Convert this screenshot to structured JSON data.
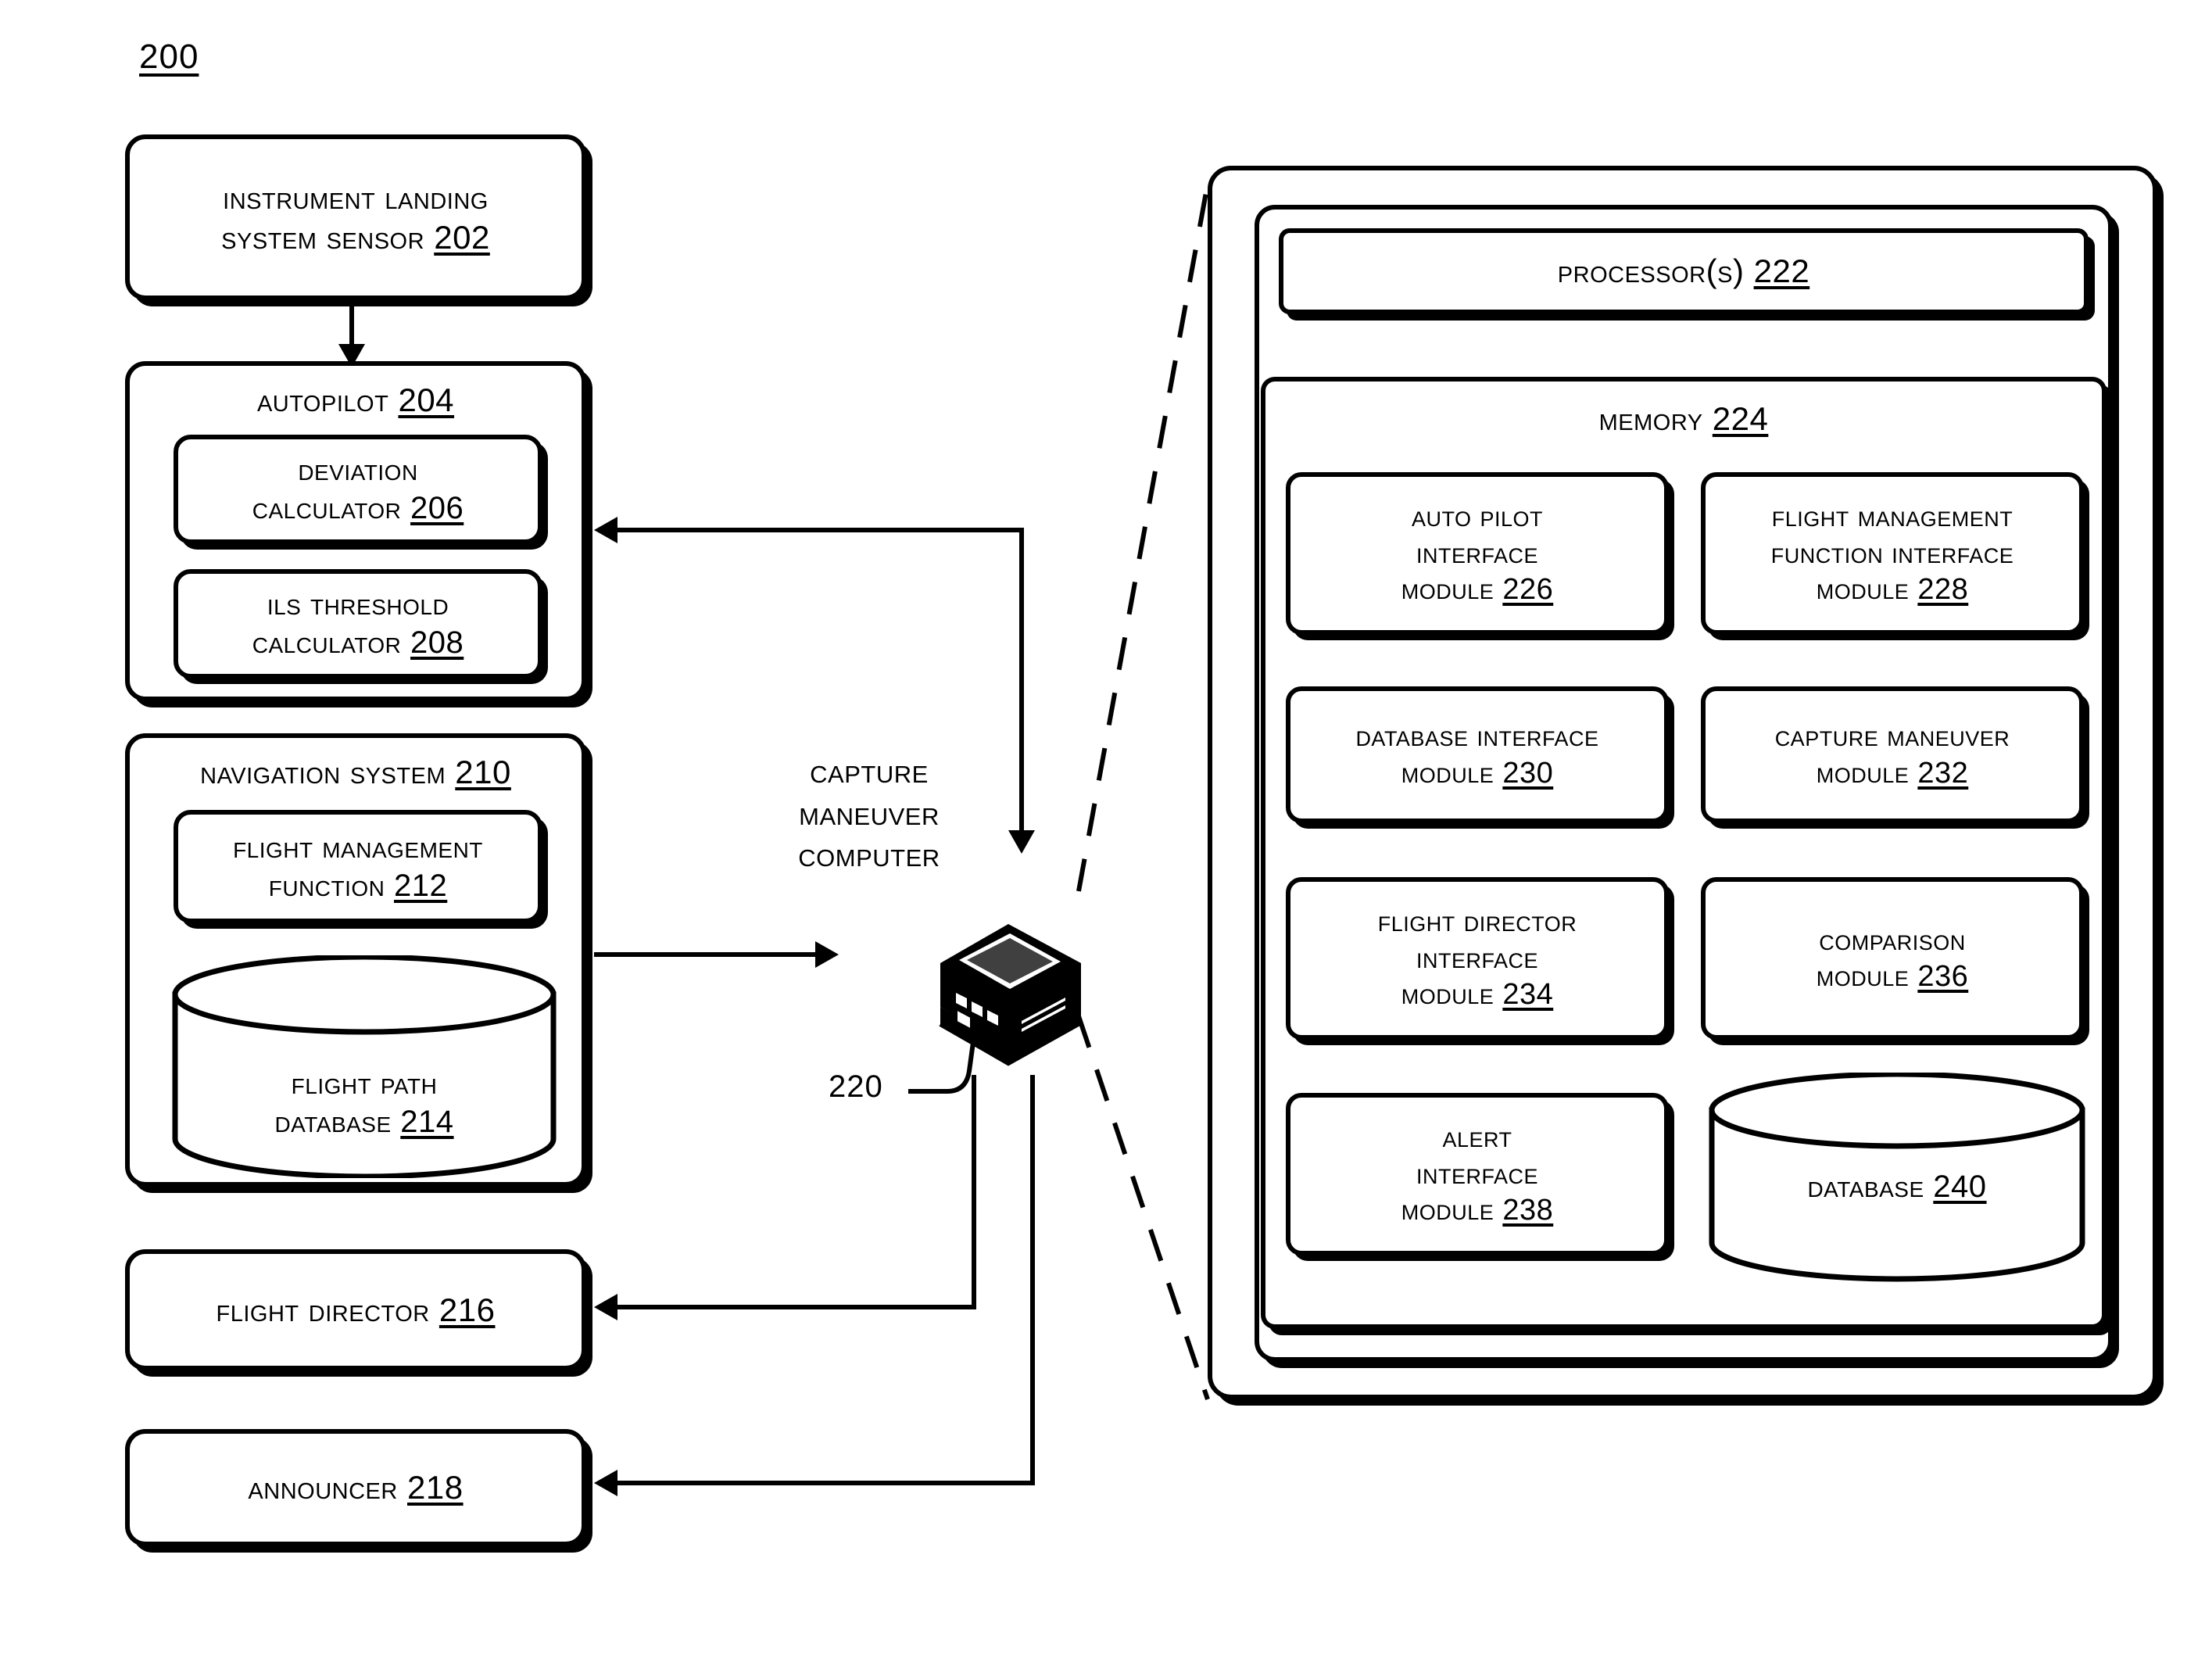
{
  "figure": {
    "number": "200"
  },
  "left_column": {
    "ils_sensor": {
      "line1": "Instrument Landing",
      "line2": "System Sensor",
      "ref": "202"
    },
    "autopilot": {
      "title": "Autopilot",
      "ref": "204",
      "children": [
        {
          "line1": "Deviation",
          "line2": "Calculator",
          "ref": "206"
        },
        {
          "line1": "ILS Threshold",
          "line2": "Calculator",
          "ref": "208"
        }
      ]
    },
    "navigation_system": {
      "title": "Navigation System",
      "ref": "210",
      "fmf": {
        "line1": "Flight Management",
        "line2": "Function",
        "ref": "212"
      },
      "flight_path_db": {
        "line1": "Flight Path",
        "line2": "Database",
        "ref": "214"
      }
    },
    "flight_director": {
      "title": "Flight Director",
      "ref": "216"
    },
    "announcer": {
      "title": "Announcer",
      "ref": "218"
    }
  },
  "center": {
    "computer_label_line1": "Capture",
    "computer_label_line2": "Maneuver",
    "computer_label_line3": "Computer",
    "callout_ref": "220",
    "icon": "computer-server-icon"
  },
  "right_panel": {
    "processor": {
      "title": "Processor(s)",
      "ref": "222"
    },
    "memory": {
      "title": "Memory",
      "ref": "224",
      "modules": [
        {
          "lines": [
            "Auto Pilot",
            "Interface",
            "Module"
          ],
          "ref": "226"
        },
        {
          "lines": [
            "Flight management",
            "function Interface",
            "Module"
          ],
          "ref": "228"
        },
        {
          "lines": [
            "Database Interface",
            "Module"
          ],
          "ref": "230"
        },
        {
          "lines": [
            "Capture Maneuver",
            "Module"
          ],
          "ref": "232"
        },
        {
          "lines": [
            "Flight Director",
            "Interface",
            "Module"
          ],
          "ref": "234"
        },
        {
          "lines": [
            "Comparison",
            "Module"
          ],
          "ref": "236"
        },
        {
          "lines": [
            "Alert",
            "Interface",
            "Module"
          ],
          "ref": "238"
        }
      ],
      "database": {
        "title": "Database",
        "ref": "240"
      }
    }
  },
  "colors": {
    "ink": "#000000",
    "paper": "#ffffff"
  }
}
